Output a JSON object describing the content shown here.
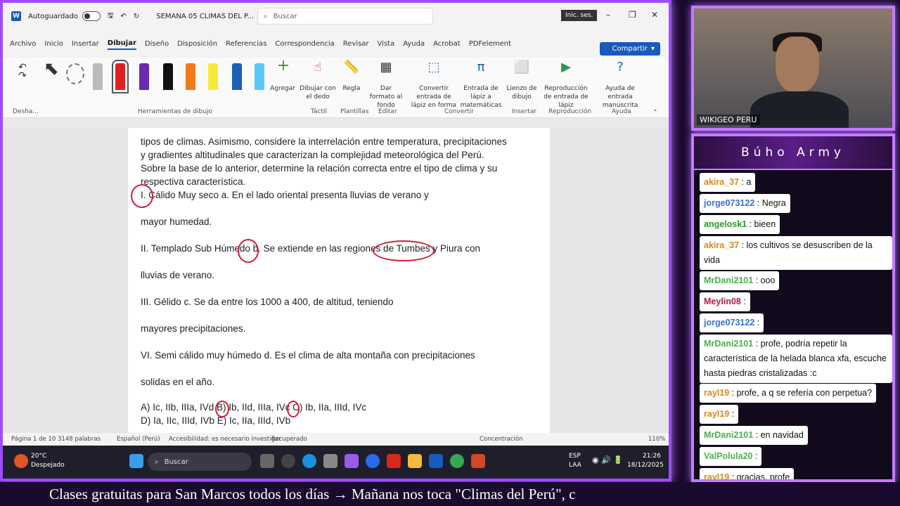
{
  "window": {
    "autosave_label": "Autoguardado",
    "doc_title": "SEMANA 05 CLIMAS DEL P...",
    "search_placeholder": "Buscar",
    "signin": "Inic. ses.",
    "share": "Compartir"
  },
  "menu": [
    "Archivo",
    "Inicio",
    "Insertar",
    "Dibujar",
    "Diseño",
    "Disposición",
    "Referencias",
    "Correspondencia",
    "Revisar",
    "Vista",
    "Ayuda",
    "Acrobat",
    "PDFelement"
  ],
  "ribbon": {
    "undo_group": "Desha...",
    "tools_group": "Herramientas de dibujo",
    "add": "Agregar",
    "draw_finger": "Dibujar con el dedo",
    "ruler": "Regla",
    "background": "Dar formato al fondo",
    "convert_shape": "Convertir entrada de lápiz en forma",
    "math": "Entrada de lápiz a matemáticas",
    "canvas": "Lienzo de dibujo",
    "replay": "Reproducción de entrada de lápiz",
    "help_ink": "Ayuda de entrada manuscrita",
    "groups": {
      "tactil": "Táctil",
      "plantillas": "Plantillas",
      "editar": "Editar",
      "convertir": "Convertir",
      "insertar": "Insertar",
      "reproduccion": "Reproducción",
      "ayuda": "Ayuda"
    }
  },
  "document": {
    "lines": [
      "tipos de climas. Asimismo, considere la interrelación entre temperatura, precipitaciones",
      "y gradientes altitudinales que caracterizan la complejidad meteorológica del Perú.",
      "Sobre la base de lo anterior, determine la relación correcta entre el tipo de clima y su",
      "respectiva característica.",
      "I. Cálido Muy seco a. En el lado oriental presenta lluvias de verano y",
      "mayor humedad.",
      "II. Templado Sub Húmedo b. Se extiende en las regiones de Tumbes y Piura con",
      "lluvias de verano.",
      "III. Gélido c. Se da entre los 1000 a 400, de altitud, teniendo",
      "mayores precipitaciones.",
      "VI. Semi cálido muy húmedo d. Es el clima de alta montaña con precipitaciones",
      "solidas en el año.",
      "A) Ic, IIb, IIIa, IVd B) Ib, IId, IIIa, IVc C) Ib, IIa, IIId, IVc",
      "D) Ia, IIc, IIId, IVb E) Ic, IIa, IIId, IVb"
    ]
  },
  "status": {
    "page": "Página 1 de 10",
    "words": "3148 palabras",
    "lang": "Español (Perú)",
    "access": "Accesibilidad: es necesario investigar",
    "recovered": "Recuperado",
    "focus": "Concentración",
    "zoom": "110%"
  },
  "taskbar": {
    "temp": "20°C",
    "weather": "Despejado",
    "search": "Buscar",
    "lang1": "ESP",
    "lang2": "LAA",
    "time": "21:26",
    "date": "18/12/2025"
  },
  "webcam": {
    "label": "WIKIGEO PERU"
  },
  "chat": {
    "title": "Búho Army",
    "messages": [
      {
        "user": "akira_37",
        "text": "a",
        "color": "#d98a1a"
      },
      {
        "user": "jorge073122",
        "text": "Negra",
        "color": "#3b6fd6"
      },
      {
        "user": "angelosk1",
        "text": "bieen",
        "color": "#2c9a2c"
      },
      {
        "user": "akira_37",
        "text": "los cultivos se desuscriben de la vida",
        "color": "#d98a1a"
      },
      {
        "user": "MrDani2101",
        "text": "ooo",
        "color": "#4caf50"
      },
      {
        "user": "Meylin08",
        "text": "",
        "color": "#b01c4a"
      },
      {
        "user": "jorge073122",
        "text": "",
        "color": "#3b6fd6"
      },
      {
        "user": "MrDani2101",
        "text": "profe, podría repetir la característica de la helada blanca xfa, escuche hasta piedras cristalizadas :c",
        "color": "#4caf50"
      },
      {
        "user": "rayl19",
        "text": "profe, a q se refería con perpetua?",
        "color": "#d98a1a"
      },
      {
        "user": "rayl19",
        "text": "",
        "color": "#d98a1a"
      },
      {
        "user": "MrDani2101",
        "text": "en navidad",
        "color": "#4caf50"
      },
      {
        "user": "ValPolula20",
        "text": "",
        "color": "#4caf50"
      },
      {
        "user": "rayl19",
        "text": "gracias, profe",
        "color": "#d98a1a"
      }
    ]
  },
  "ticker": "Clases gratuitas para San Marcos todos los días  →  Mañana nos toca \"Climas del Perú\", c"
}
